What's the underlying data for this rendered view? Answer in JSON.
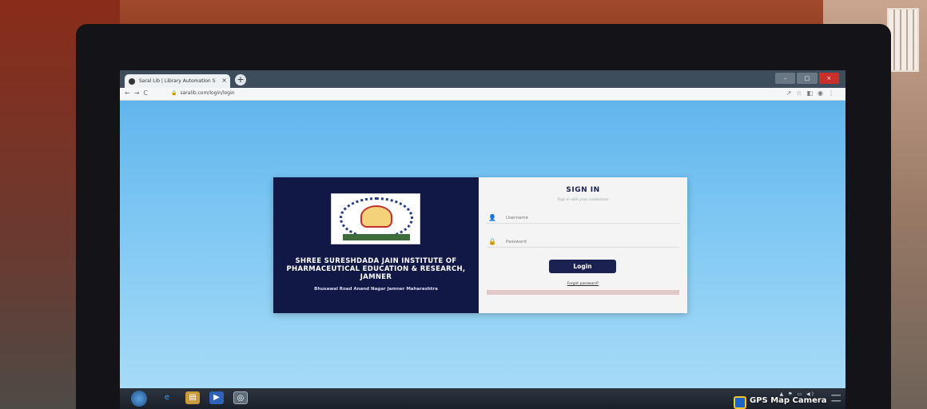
{
  "browser": {
    "tab_title": "Saral Lib | Library Automation S",
    "tab_close": "×",
    "new_tab": "+",
    "url": "saralib.com/login/login",
    "nav_buttons": [
      "←",
      "→",
      "C"
    ],
    "window_controls": [
      "–",
      "□",
      "×"
    ]
  },
  "login": {
    "institute_name": "SHREE SURESHDADA JAIN INSTITUTE OF PHARMACEUTICAL EDUCATION & RESEARCH, JAMNER",
    "institute_address": "Bhusawal Road Anand Nagar Jamner Maharashtra",
    "signin_title": "SIGN IN",
    "signin_subtitle": "Sign in with your credentials",
    "username_placeholder": "Username",
    "password_placeholder": "Password",
    "login_button": "Login",
    "forgot_password": "Forgot password?"
  },
  "taskbar": {
    "apps": [
      "ie-icon",
      "explorer-icon",
      "media-icon",
      "chrome-icon"
    ]
  },
  "watermark": {
    "text": "GPS Map Camera"
  },
  "colors": {
    "card_left_bg": "#121845",
    "accent": "#1b2150",
    "screen_bg": "#7cc6f3"
  }
}
